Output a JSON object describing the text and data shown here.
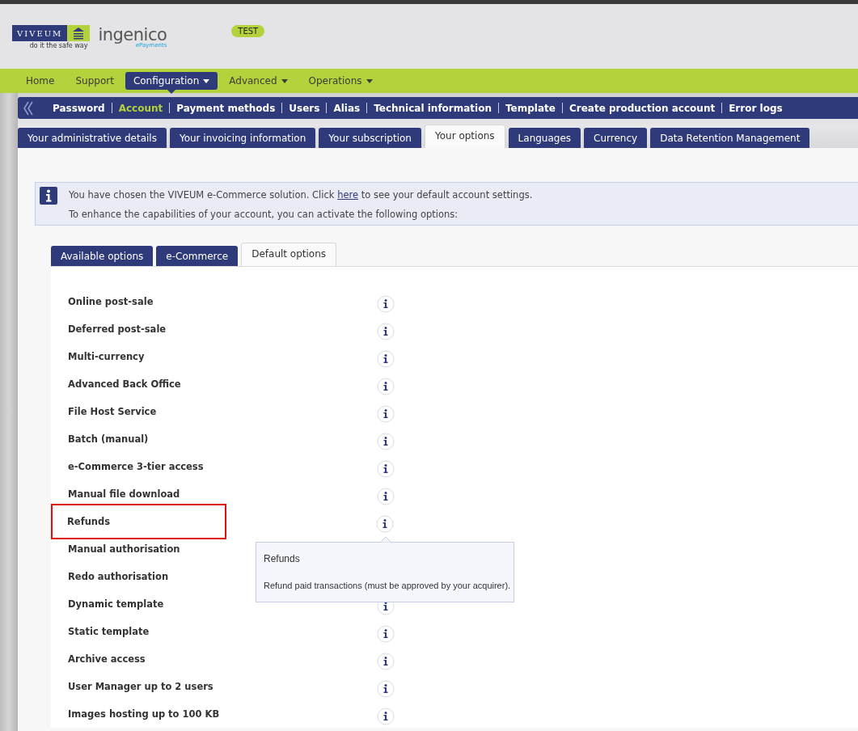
{
  "header": {
    "brand": {
      "name": "VIVEUM",
      "tagline": "do it the safe way"
    },
    "partner": {
      "name": "ingenico",
      "sub": "ePayments"
    },
    "environment_badge": "TEST"
  },
  "main_nav": [
    {
      "label": "Home",
      "selected": false,
      "dropdown": false
    },
    {
      "label": "Support",
      "selected": false,
      "dropdown": false
    },
    {
      "label": "Configuration",
      "selected": true,
      "dropdown": true
    },
    {
      "label": "Advanced",
      "selected": false,
      "dropdown": true
    },
    {
      "label": "Operations",
      "selected": false,
      "dropdown": true
    }
  ],
  "sub_nav": [
    {
      "label": "Password",
      "selected": false
    },
    {
      "label": "Account",
      "selected": true
    },
    {
      "label": "Payment methods",
      "selected": false
    },
    {
      "label": "Users",
      "selected": false
    },
    {
      "label": "Alias",
      "selected": false
    },
    {
      "label": "Technical information",
      "selected": false
    },
    {
      "label": "Template",
      "selected": false
    },
    {
      "label": "Create production account",
      "selected": false
    },
    {
      "label": "Error logs",
      "selected": false
    }
  ],
  "tabs": [
    {
      "label": "Your administrative details",
      "selected": false
    },
    {
      "label": "Your invoicing information",
      "selected": false
    },
    {
      "label": "Your subscription",
      "selected": false
    },
    {
      "label": "Your options",
      "selected": true
    },
    {
      "label": "Languages",
      "selected": false
    },
    {
      "label": "Currency",
      "selected": false
    },
    {
      "label": "Data Retention Management",
      "selected": false
    }
  ],
  "info_box": {
    "line_1_before": "You have chosen the VIVEUM e-Commerce solution. Click",
    "link": "here",
    "line_1_after": "to see your default account settings.",
    "line_2": "To enhance the capabilities of your account, you can activate the following options:"
  },
  "option_tabs": [
    {
      "label": "Available options",
      "selected": false
    },
    {
      "label": "e-Commerce",
      "selected": false
    },
    {
      "label": "Default options",
      "selected": true
    }
  ],
  "options": [
    {
      "name": "Online post-sale",
      "highlighted": false
    },
    {
      "name": "Deferred post-sale",
      "highlighted": false
    },
    {
      "name": "Multi-currency",
      "highlighted": false
    },
    {
      "name": "Advanced Back Office",
      "highlighted": false
    },
    {
      "name": "File Host Service",
      "highlighted": false
    },
    {
      "name": "Batch (manual)",
      "highlighted": false
    },
    {
      "name": "e-Commerce 3-tier access",
      "highlighted": false
    },
    {
      "name": "Manual file download",
      "highlighted": false
    },
    {
      "name": "Refunds",
      "highlighted": true
    },
    {
      "name": "Manual authorisation",
      "highlighted": false,
      "info_icon": false
    },
    {
      "name": "Redo authorisation",
      "highlighted": false,
      "info_icon": false
    },
    {
      "name": "Dynamic template",
      "highlighted": false
    },
    {
      "name": "Static template",
      "highlighted": false
    },
    {
      "name": "Archive access",
      "highlighted": false
    },
    {
      "name": "User Manager up to 2 users",
      "highlighted": false
    },
    {
      "name": "Images hosting up to 100 KB",
      "highlighted": false
    }
  ],
  "tooltip": {
    "title": "Refunds",
    "text": "Refund paid transactions (must be approved by your acquirer)."
  }
}
